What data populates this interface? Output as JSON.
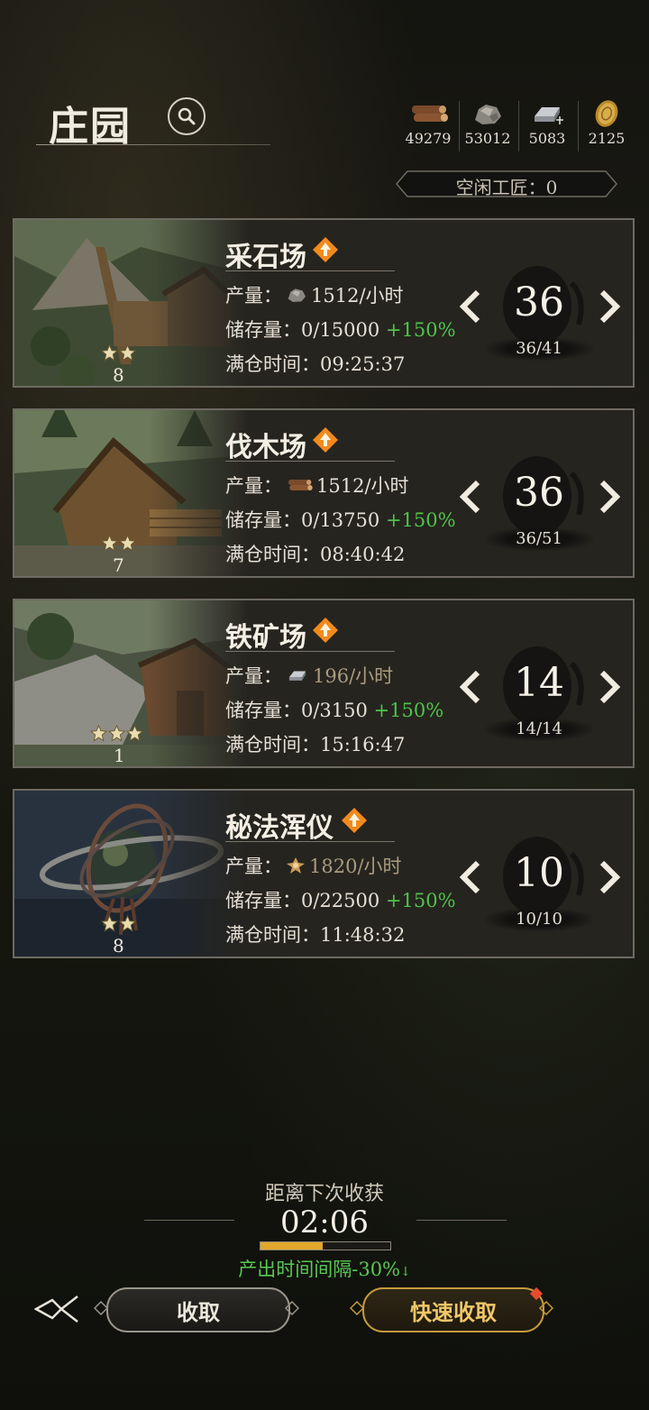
{
  "header": {
    "title": "庄园",
    "resources": [
      {
        "icon": "wood-log-icon",
        "value": "49279"
      },
      {
        "icon": "stone-ore-icon",
        "value": "53012"
      },
      {
        "icon": "iron-ingot-icon",
        "value": "5083"
      },
      {
        "icon": "gold-coin-icon",
        "value": "2125"
      }
    ],
    "idle_workers": "空闲工匠：0"
  },
  "buildings": [
    {
      "name": "采石场",
      "stars": 2,
      "level": "8",
      "production_label": "产量：",
      "production_icon": "stone-ore-icon",
      "production_value": "1512/小时",
      "storage_label": "储存量：",
      "storage_value": "0/15000",
      "storage_bonus": "+150%",
      "full_label": "满仓时间：",
      "full_time": "09:25:37",
      "workers": "36",
      "workers_ratio": "36/41",
      "production_dim": false
    },
    {
      "name": "伐木场",
      "stars": 2,
      "level": "7",
      "production_label": "产量：",
      "production_icon": "wood-log-icon",
      "production_value": "1512/小时",
      "storage_label": "储存量：",
      "storage_value": "0/13750",
      "storage_bonus": "+150%",
      "full_label": "满仓时间：",
      "full_time": "08:40:42",
      "workers": "36",
      "workers_ratio": "36/51",
      "production_dim": false
    },
    {
      "name": "铁矿场",
      "stars": 3,
      "level": "1",
      "production_label": "产量：",
      "production_icon": "iron-ingot-icon",
      "production_value": "196/小时",
      "storage_label": "储存量：",
      "storage_value": "0/3150",
      "storage_bonus": "+150%",
      "full_label": "满仓时间：",
      "full_time": "15:16:47",
      "workers": "14",
      "workers_ratio": "14/14",
      "production_dim": true
    },
    {
      "name": "秘法浑仪",
      "stars": 2,
      "level": "8",
      "production_label": "产量：",
      "production_icon": "arcane-crystal-icon",
      "production_value": "1820/小时",
      "storage_label": "储存量：",
      "storage_value": "0/22500",
      "storage_bonus": "+150%",
      "full_label": "满仓时间：",
      "full_time": "11:48:32",
      "workers": "10",
      "workers_ratio": "10/10",
      "production_dim": true
    }
  ],
  "footer": {
    "next_harvest_label": "距离下次收获",
    "next_harvest_time": "02:06",
    "progress": 0.48,
    "interval_text": "产出时间间隔-30%",
    "collect_label": "收取",
    "quick_collect_label": "快速收取"
  },
  "colors": {
    "bonus_green": "#4fc34a",
    "accent_gold": "#e1a82c",
    "upgrade_orange": "#f28a1c"
  }
}
